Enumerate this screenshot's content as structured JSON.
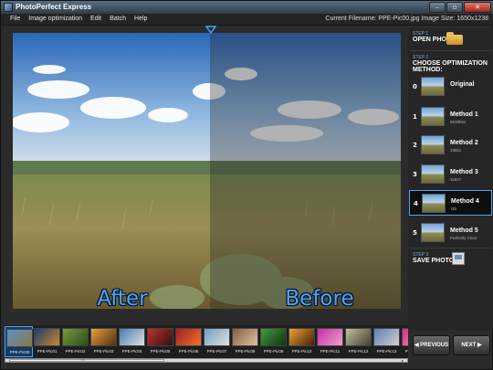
{
  "window": {
    "title": "PhotoPerfect Express",
    "buttons": [
      "–",
      "▫",
      "✕"
    ]
  },
  "menu": {
    "items": [
      {
        "label": "File",
        "key": "F"
      },
      {
        "label": "Image optimization",
        "key": "I"
      },
      {
        "label": "Edit",
        "key": "E"
      },
      {
        "label": "Batch",
        "key": "B"
      },
      {
        "label": "Help",
        "key": "H"
      }
    ]
  },
  "fileinfo": {
    "text": "Current Filename: PPE-Pic00.jpg   Image Size: 1650x1238"
  },
  "viewer": {
    "after_label": "After enhancement",
    "before_label": "Before enhancement",
    "split_marker_color": "#4aa3ff"
  },
  "steps": {
    "step1_small": "STEP 1",
    "step1_big": "OPEN PHOTO",
    "step2_small": "STEP 2",
    "step2_big": "CHOOSE OPTIMIZATION METHOD:",
    "step3_small": "STEP 3",
    "step3_big": "SAVE PHOTO AS"
  },
  "methods": [
    {
      "num": "0",
      "name": "Original",
      "sub": ""
    },
    {
      "num": "1",
      "name": "Method 1",
      "sub": "8638bbx"
    },
    {
      "num": "2",
      "name": "Method 2",
      "sub": "19bbx"
    },
    {
      "num": "3",
      "name": "Method 3",
      "sub": "3x847"
    },
    {
      "num": "4",
      "name": "Method 4",
      "sub": "i3b"
    },
    {
      "num": "5",
      "name": "Method 5",
      "sub": "Perfectly Clear"
    }
  ],
  "selected_method": 4,
  "filmstrip": [
    {
      "label": "PPE-Pic00"
    },
    {
      "label": "PPE-Pic01"
    },
    {
      "label": "PPE-Pic02"
    },
    {
      "label": "PPE-Pic03"
    },
    {
      "label": "PPE-Pic04"
    },
    {
      "label": "PPE-Pic05"
    },
    {
      "label": "PPE-Pic06"
    },
    {
      "label": "PPE-Pic07"
    },
    {
      "label": "PPE-Pic08"
    },
    {
      "label": "PPE-Pic09"
    },
    {
      "label": "PPE-Pic10"
    },
    {
      "label": "PPE-Pic11"
    },
    {
      "label": "PPE-Pic12"
    },
    {
      "label": "PPE-Pic13"
    },
    {
      "label": "PPE-Pic14"
    }
  ],
  "selected_thumb": 0,
  "nav": {
    "prev": "PREVIOUS",
    "next": "NEXT"
  }
}
